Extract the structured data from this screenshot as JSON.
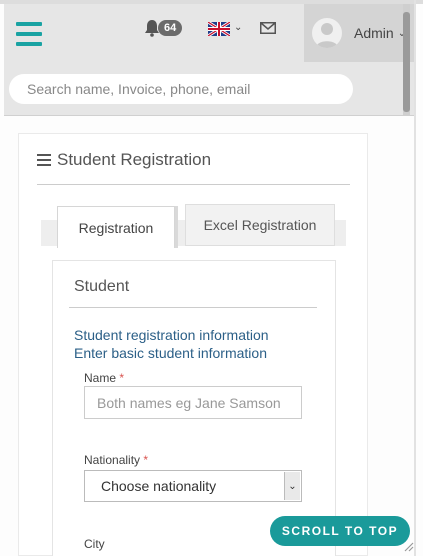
{
  "header": {
    "notifications_count": "64",
    "user_name": "Admin",
    "language_flag": "uk-flag-icon",
    "search_placeholder": "Search name, Invoice, phone, email"
  },
  "panel": {
    "title": "Student Registration",
    "tabs": [
      {
        "label": "Registration",
        "active": true
      },
      {
        "label": "Excel Registration",
        "active": false
      }
    ]
  },
  "form": {
    "section_title": "Student",
    "info_line1": "Student registration information",
    "info_line2": "Enter basic student information",
    "name_label": "Name",
    "name_placeholder": "Both names eg Jane Samson",
    "nationality_label": "Nationality",
    "nationality_value": "Choose nationality",
    "city_label": "City",
    "required_mark": "*"
  },
  "scroll_top_label": "SCROLL TO TOP",
  "colors": {
    "accent": "#1a9a9a",
    "info_text": "#2b5f87",
    "required": "#d9534f"
  }
}
